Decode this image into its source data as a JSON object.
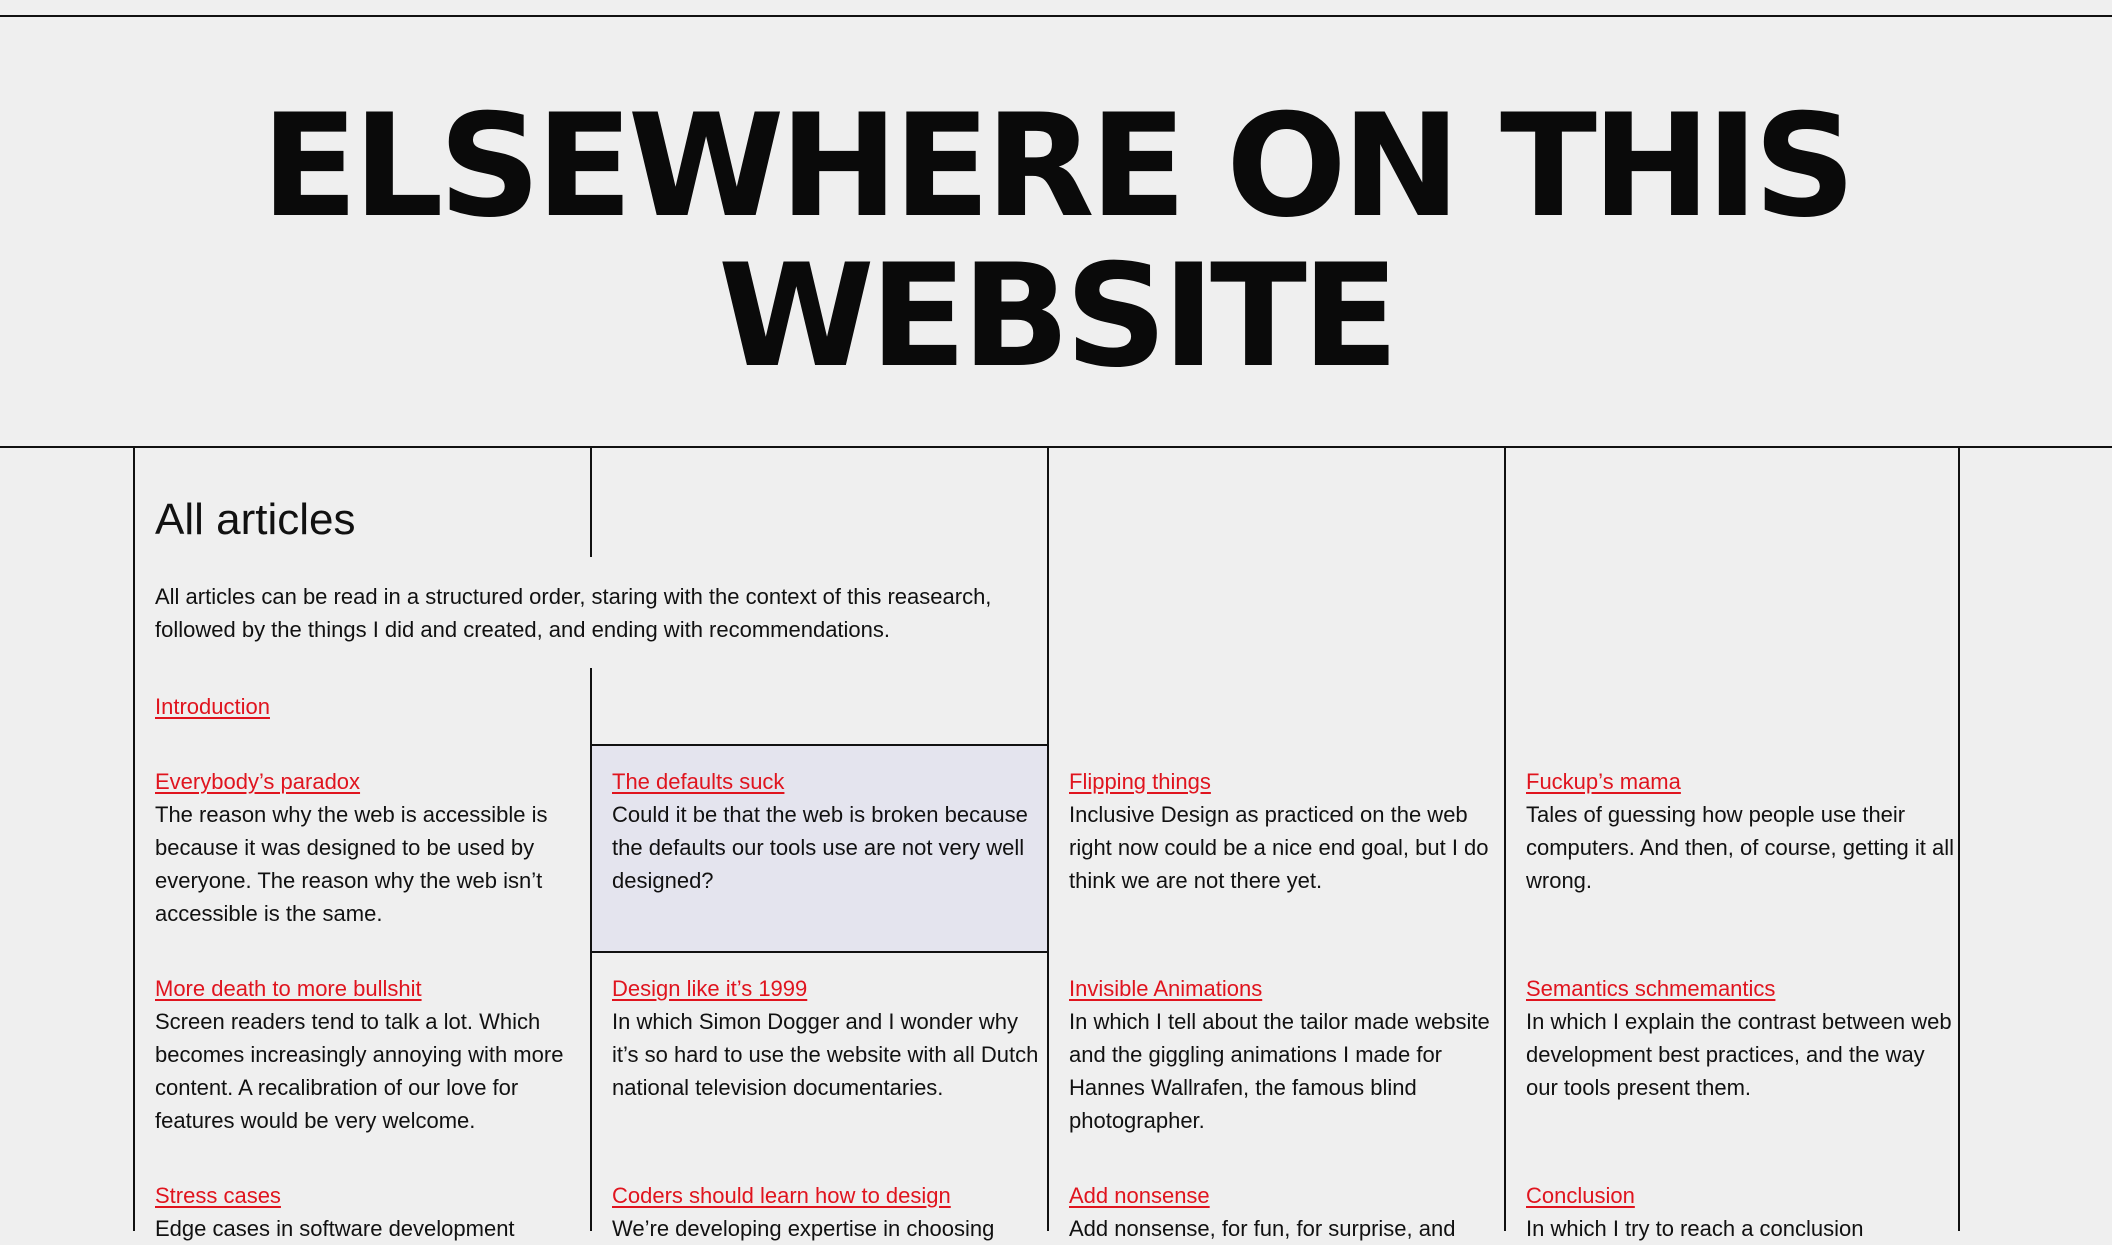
{
  "hero": {
    "title": "ELSEWHERE ON THIS WEBSITE"
  },
  "intro": {
    "heading": "All articles",
    "text": "All articles can be read in a structured order, staring with the context of this reasearch, followed by the things I did and created, and ending with recommendations.",
    "link": "Introduction"
  },
  "articles": [
    {
      "title": "Everybody’s paradox",
      "desc": "The reason why the web is accessible is because it was designed to be used by everyone. The reason why the web isn’t accessible is the same."
    },
    {
      "title": "The defaults suck",
      "desc": "Could it be that the web is broken because the defaults our tools use are not very well designed?"
    },
    {
      "title": "Flipping things",
      "desc": "Inclusive Design as practiced on the web right now could be a nice end goal, but I do think we are not there yet."
    },
    {
      "title": "Fuckup’s mama",
      "desc": "Tales of guessing how people use their computers. And then, of course, getting it all wrong."
    },
    {
      "title": "More death to more bullshit",
      "desc": "Screen readers tend to talk a lot. Which becomes increasingly annoying with more content. A recalibration of our love for features would be very welcome."
    },
    {
      "title": "Design like it’s 1999",
      "desc": "In which Simon Dogger and I wonder why it’s so hard to use the website with all Dutch national television documentaries."
    },
    {
      "title": "Invisible Animations",
      "desc": "In which I tell about the tailor made website and the giggling animations I made for Hannes Wallrafen, the famous blind photographer."
    },
    {
      "title": "Semantics schmemantics",
      "desc": "In which I explain the contrast between web development best practices, and the way our tools present them."
    },
    {
      "title": "Stress cases",
      "desc": "Edge cases in software development"
    },
    {
      "title": "Coders should learn how to design",
      "desc": "We’re developing expertise in choosing"
    },
    {
      "title": "Add nonsense",
      "desc": "Add nonsense, for fun, for surprise, and"
    },
    {
      "title": "Conclusion",
      "desc": "In which I try to reach a conclusion"
    }
  ]
}
